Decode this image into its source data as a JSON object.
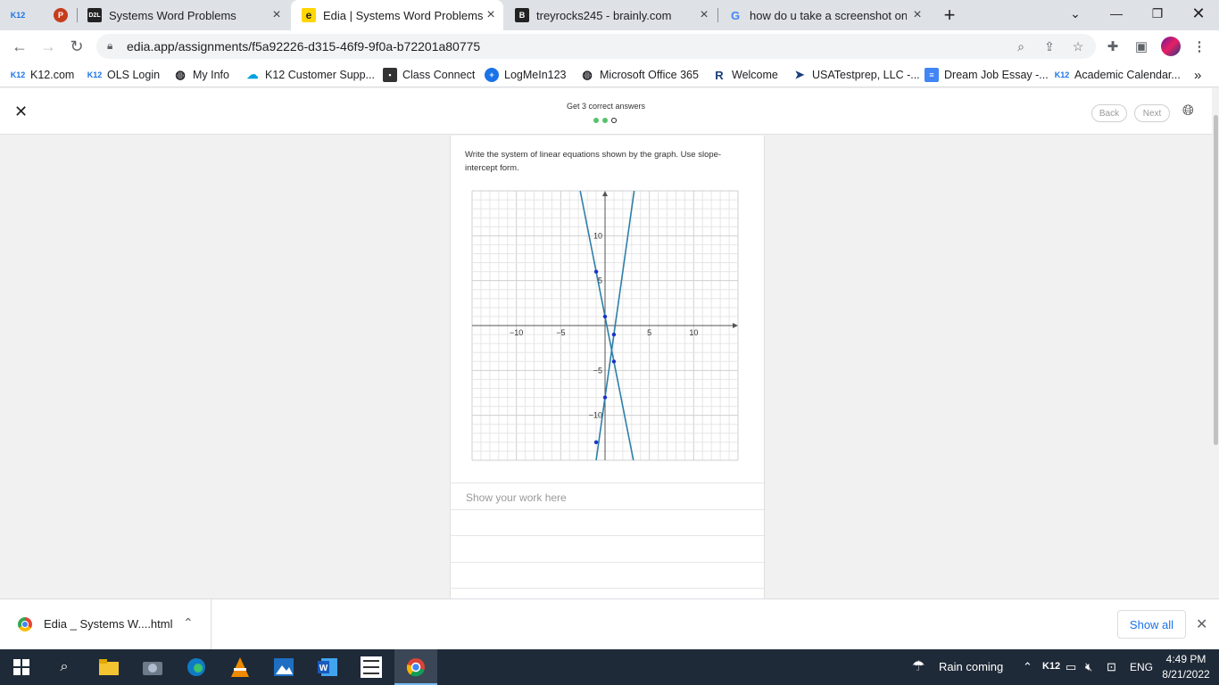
{
  "browser": {
    "tabs": [
      {
        "label": "",
        "favicon": "K12"
      },
      {
        "label": "",
        "favicon": "P"
      },
      {
        "label": "Systems Word Problems",
        "favicon": "D2L"
      },
      {
        "label": "Edia | Systems Word Problems",
        "favicon": "e",
        "active": true
      },
      {
        "label": "treyrocks245 - brainly.com",
        "favicon": "B"
      },
      {
        "label": "how do u take a screenshot on h",
        "favicon": "G"
      }
    ],
    "new_tab_label": "+",
    "url": "edia.app/assignments/f5a92226-d315-46f9-9f0a-b72201a80775",
    "bookmarks": [
      {
        "label": "K12.com",
        "icon": "K12"
      },
      {
        "label": "OLS Login",
        "icon": "K12"
      },
      {
        "label": "My Info",
        "icon": "globe-icon"
      },
      {
        "label": "K12 Customer Supp...",
        "icon": "cloud-icon"
      },
      {
        "label": "Class Connect",
        "icon": "camera-icon"
      },
      {
        "label": "LogMeIn123",
        "icon": "plus-circle-icon"
      },
      {
        "label": "Microsoft Office 365",
        "icon": "globe-icon"
      },
      {
        "label": "Welcome",
        "icon": "R"
      },
      {
        "label": "USATestprep, LLC -...",
        "icon": "cursor-icon"
      },
      {
        "label": "Dream Job Essay -...",
        "icon": "doc-icon"
      },
      {
        "label": "Academic Calendar...",
        "icon": "K12"
      }
    ],
    "more_bookmarks": "»"
  },
  "app": {
    "progress_label": "Get 3 correct answers",
    "progress": {
      "completed": 2,
      "total": 3
    },
    "back_label": "Back",
    "next_label": "Next",
    "question": "Write the system of linear equations shown by the graph. Use slope-intercept form.",
    "work_placeholder": "Show your work here"
  },
  "chart_data": {
    "type": "line",
    "title": "",
    "xlabel": "",
    "ylabel": "",
    "xlim": [
      -15,
      15
    ],
    "ylim": [
      -15,
      15
    ],
    "grid": true,
    "x_ticks": [
      -10,
      -5,
      5,
      10
    ],
    "y_ticks": [
      10,
      5,
      -5,
      -10
    ],
    "x_tick_labels": [
      "−10",
      "−5",
      "5",
      "10"
    ],
    "y_tick_labels": [
      "10",
      "5",
      "−5",
      "−10"
    ],
    "series": [
      {
        "equation": "y = -5x + 1",
        "slope": -5,
        "intercept": 1,
        "points": [
          [
            -1,
            6
          ],
          [
            0,
            1
          ],
          [
            1,
            -4
          ]
        ],
        "color": "#2e7fa8"
      },
      {
        "equation": "y = 7x - 8",
        "slope": 7,
        "intercept": -8,
        "points": [
          [
            -1,
            -13
          ],
          [
            0,
            -8
          ],
          [
            1,
            -1
          ]
        ],
        "color": "#2e7fa8"
      }
    ],
    "point_color": "#1a33c9"
  },
  "downloads": {
    "file_name": "Edia _ Systems W....html",
    "show_all_label": "Show all"
  },
  "taskbar": {
    "weather": "Rain coming",
    "language": "ENG",
    "tray_k12": "K12",
    "time": "4:49 PM",
    "date": "8/21/2022"
  }
}
